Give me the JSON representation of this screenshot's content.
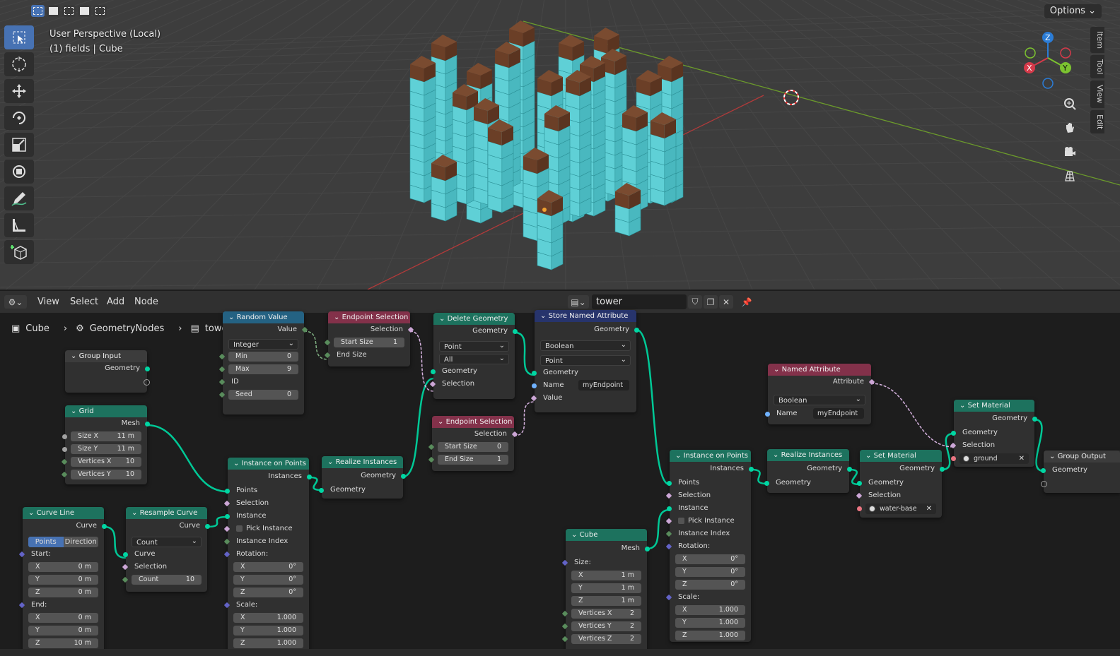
{
  "viewport": {
    "select_modes": [
      "select-box",
      "select-extend",
      "select-subtract",
      "select-invert",
      "select-intersect"
    ],
    "options_label": "Options",
    "view_name": "User Perspective (Local)",
    "object_info": "(1) fields | Cube",
    "tools": [
      "select-box-icon",
      "cursor-icon",
      "move-icon",
      "rotate-icon",
      "scale-icon",
      "transform-icon",
      "annotate-icon",
      "measure-icon",
      "add-cube-icon"
    ],
    "side_tabs": [
      "Item",
      "Tool",
      "View",
      "Edit"
    ],
    "gizmo": {
      "x": "X",
      "y": "Y",
      "z": "Z"
    },
    "colors": {
      "cube_side": "#5fd0d6",
      "cube_top": "#7a4b30",
      "grid": "#464646",
      "x_axis": "#b23a3a",
      "y_axis": "#6b9a2b"
    }
  },
  "editor": {
    "menus": [
      "View",
      "Select",
      "Add",
      "Node"
    ],
    "tree_name": "tower",
    "breadcrumb": [
      "Cube",
      "GeometryNodes",
      "tower"
    ]
  },
  "nodes": {
    "group_input": {
      "title": "Group Input",
      "geometry": "Geometry"
    },
    "grid": {
      "title": "Grid",
      "mesh": "Mesh",
      "size_x_k": "Size X",
      "size_x_v": "11 m",
      "size_y_k": "Size Y",
      "size_y_v": "11 m",
      "vx_k": "Vertices X",
      "vx_v": "10",
      "vy_k": "Vertices Y",
      "vy_v": "10"
    },
    "random_value": {
      "title": "Random Value",
      "value": "Value",
      "type": "Integer",
      "min_k": "Min",
      "min_v": "0",
      "max_k": "Max",
      "max_v": "9",
      "id": "ID",
      "seed_k": "Seed",
      "seed_v": "0"
    },
    "endpoint1": {
      "title": "Endpoint Selection",
      "selection": "Selection",
      "start_k": "Start Size",
      "start_v": "1",
      "end": "End Size"
    },
    "delete_geo": {
      "title": "Delete Geometry",
      "geometry_out": "Geometry",
      "domain": "Point",
      "mode": "All",
      "geometry_in": "Geometry",
      "selection": "Selection"
    },
    "endpoint2": {
      "title": "Endpoint Selection",
      "selection": "Selection",
      "start_k": "Start Size",
      "start_v": "0",
      "end_k": "End Size",
      "end_v": "1"
    },
    "store_attr": {
      "title": "Store Named Attribute",
      "geometry_out": "Geometry",
      "type": "Boolean",
      "domain": "Point",
      "geometry_in": "Geometry",
      "name_k": "Name",
      "name_v": "myEndpoint",
      "value": "Value"
    },
    "named_attr": {
      "title": "Named Attribute",
      "attribute": "Attribute",
      "type": "Boolean",
      "name_k": "Name",
      "name_v": "myEndpoint"
    },
    "curve_line": {
      "title": "Curve Line",
      "curve": "Curve",
      "mode_a": "Points",
      "mode_b": "Direction",
      "start": "Start:",
      "sx": "0 m",
      "sy": "0 m",
      "sz": "0 m",
      "end": "End:",
      "ex": "0 m",
      "ey": "0 m",
      "ez": "10 m",
      "x": "X",
      "y": "Y",
      "z": "Z"
    },
    "resample": {
      "title": "Resample Curve",
      "curve_out": "Curve",
      "mode": "Count",
      "curve_in": "Curve",
      "selection": "Selection",
      "count_k": "Count",
      "count_v": "10"
    },
    "iop1": {
      "title": "Instance on Points",
      "instances": "Instances",
      "points": "Points",
      "selection": "Selection",
      "instance": "Instance",
      "pick": "Pick Instance",
      "index": "Instance Index",
      "rotation": "Rotation:",
      "rx": "0°",
      "ry": "0°",
      "rz": "0°",
      "scale": "Scale:",
      "scx": "1.000",
      "scy": "1.000",
      "scz": "1.000"
    },
    "realize1": {
      "title": "Realize Instances",
      "geometry_out": "Geometry",
      "geometry_in": "Geometry"
    },
    "cube": {
      "title": "Cube",
      "mesh": "Mesh",
      "size": "Size:",
      "sx": "1 m",
      "sy": "1 m",
      "sz": "1 m",
      "vx_k": "Vertices X",
      "vx_v": "2",
      "vy_k": "Vertices Y",
      "vy_v": "2",
      "vz_k": "Vertices Z",
      "vz_v": "2"
    },
    "iop2": {
      "title": "Instance on Points",
      "instances": "Instances",
      "points": "Points",
      "selection": "Selection",
      "instance": "Instance",
      "pick": "Pick Instance",
      "index": "Instance Index",
      "rotation": "Rotation:",
      "rx": "0°",
      "ry": "0°",
      "rz": "0°",
      "scale": "Scale:",
      "scx": "1.000",
      "scy": "1.000",
      "scz": "1.000"
    },
    "realize2": {
      "title": "Realize Instances",
      "geometry_out": "Geometry",
      "geometry_in": "Geometry"
    },
    "setmat1": {
      "title": "Set Material",
      "geometry_out": "Geometry",
      "geometry_in": "Geometry",
      "selection": "Selection",
      "material": "water-base"
    },
    "setmat2": {
      "title": "Set Material",
      "geometry_out": "Geometry",
      "geometry_in": "Geometry",
      "selection": "Selection",
      "material": "ground"
    },
    "group_output": {
      "title": "Group Output",
      "geometry": "Geometry"
    }
  }
}
